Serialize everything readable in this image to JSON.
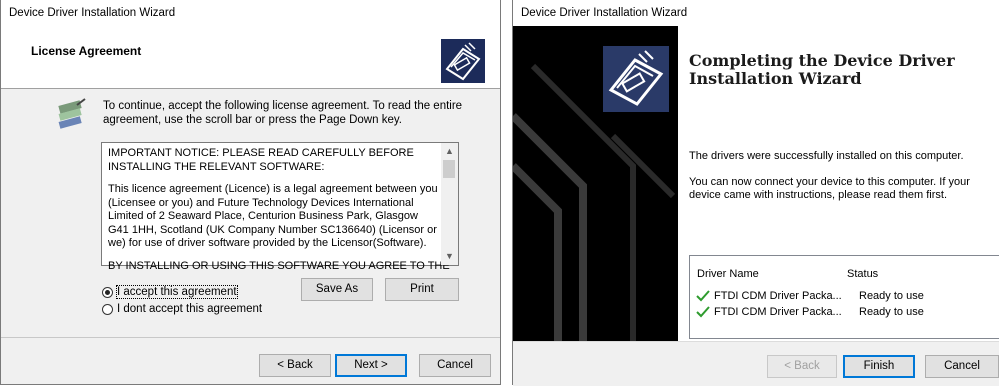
{
  "left_dialog": {
    "title": "Device Driver Installation Wizard",
    "header_title": "License Agreement",
    "intro": "To continue, accept the following license agreement. To read the entire agreement, use the scroll bar or press the Page Down key.",
    "license_para1": "IMPORTANT NOTICE: PLEASE READ CAREFULLY BEFORE INSTALLING THE RELEVANT SOFTWARE:",
    "license_para2": "This licence agreement (Licence) is a legal agreement between you (Licensee or you) and Future Technology Devices International Limited of 2 Seaward Place, Centurion Business Park, Glasgow G41 1HH, Scotland (UK Company Number SC136640) (Licensor or we) for use of driver software provided by the Licensor(Software).",
    "license_para3": "BY INSTALLING OR USING THIS SOFTWARE YOU AGREE TO THE",
    "radio_accept": "I accept this agreement",
    "radio_decline": "I dont accept this agreement",
    "save_as": "Save As",
    "print": "Print",
    "back": "< Back",
    "next": "Next >",
    "cancel": "Cancel"
  },
  "right_dialog": {
    "title": "Device Driver Installation Wizard",
    "heading": "Completing the Device Driver Installation Wizard",
    "line1": "The drivers were successfully installed on this computer.",
    "line2": "You can now connect your device to this computer. If your device came with instructions, please read them first.",
    "table": {
      "headers": [
        "Driver Name",
        "Status"
      ],
      "rows": [
        {
          "name": "FTDI CDM Driver Packa...",
          "status": "Ready to use"
        },
        {
          "name": "FTDI CDM Driver Packa...",
          "status": "Ready to use"
        }
      ]
    },
    "back": "< Back",
    "finish": "Finish",
    "cancel": "Cancel"
  },
  "colors": {
    "accent": "#0078d7",
    "check": "#2e9b2e"
  }
}
